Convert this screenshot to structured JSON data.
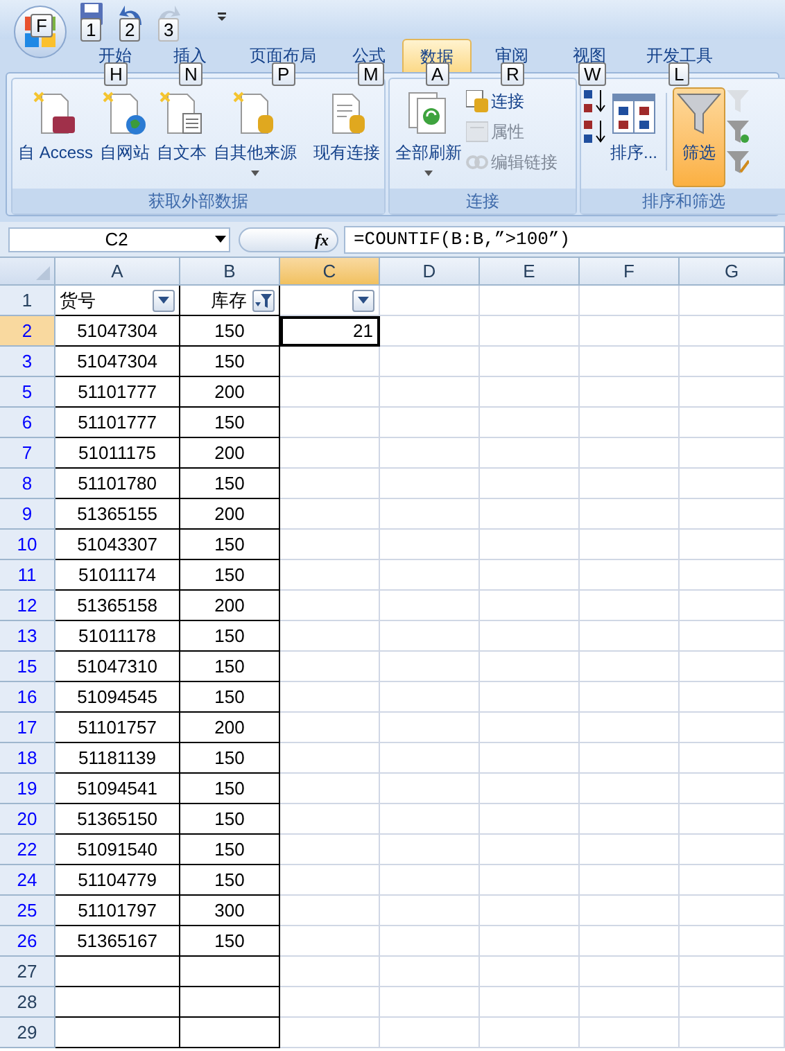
{
  "title_bar": {
    "office_button_keytip": "F",
    "quick_access": [
      {
        "keytip": "1",
        "disabled": false
      },
      {
        "keytip": "2",
        "disabled": false
      },
      {
        "keytip": "3",
        "disabled": true
      }
    ]
  },
  "tabs": [
    {
      "label": "开始",
      "keytip": "H",
      "selected": false
    },
    {
      "label": "插入",
      "keytip": "N",
      "selected": false
    },
    {
      "label": "页面布局",
      "keytip": "P",
      "selected": false
    },
    {
      "label": "公式",
      "keytip": "M",
      "selected": false
    },
    {
      "label": "数据",
      "keytip": "A",
      "selected": true
    },
    {
      "label": "审阅",
      "keytip": "R",
      "selected": false
    },
    {
      "label": "视图",
      "keytip": "W",
      "selected": false
    },
    {
      "label": "开发工具",
      "keytip": "L",
      "selected": false
    }
  ],
  "ribbon": {
    "groups": [
      {
        "title": "获取外部数据",
        "items": [
          {
            "kind": "large",
            "label": "自 Access",
            "dropdown": false,
            "on": false
          },
          {
            "kind": "large",
            "label": "自网站",
            "dropdown": false,
            "on": false
          },
          {
            "kind": "large",
            "label": "自文本",
            "dropdown": false,
            "on": false
          },
          {
            "kind": "large",
            "label": "自其他来源",
            "dropdown": true,
            "on": false
          },
          {
            "kind": "separator"
          },
          {
            "kind": "large",
            "label": "现有连接",
            "dropdown": false,
            "on": false
          }
        ]
      },
      {
        "title": "连接",
        "items": [
          {
            "kind": "large",
            "label": "全部刷新",
            "dropdown": true,
            "on": false
          },
          {
            "kind": "stack",
            "items": [
              {
                "label": "连接",
                "disabled": false
              },
              {
                "label": "属性",
                "disabled": true
              },
              {
                "label": "编辑链接",
                "disabled": true
              }
            ]
          }
        ]
      },
      {
        "title": "排序和筛选",
        "items": [
          {
            "kind": "stack",
            "items": [
              {
                "disabled": false
              },
              {
                "disabled": false
              }
            ]
          },
          {
            "kind": "large",
            "label": "排序...",
            "dropdown": false,
            "on": false
          },
          {
            "kind": "separator"
          },
          {
            "kind": "large",
            "label": "筛选",
            "dropdown": false,
            "on": true
          },
          {
            "kind": "stack",
            "items": [
              {
                "disabled": true
              },
              {
                "disabled": false
              },
              {
                "disabled": false
              }
            ]
          }
        ]
      }
    ]
  },
  "formula_bar": {
    "name_box": "C2",
    "function_button": "fx",
    "formula": "=COUNTIF(B:B,”>100”)"
  },
  "columns": [
    {
      "label": "A",
      "selected": false
    },
    {
      "label": "B",
      "selected": false
    },
    {
      "label": "C",
      "selected": true
    },
    {
      "label": "D",
      "selected": false
    },
    {
      "label": "E",
      "selected": false
    },
    {
      "label": "F",
      "selected": false
    },
    {
      "label": "G",
      "selected": false
    }
  ],
  "header_row": {
    "number": "1",
    "cells": [
      {
        "text": "货号",
        "filtered": false
      },
      {
        "text": "库存",
        "filtered": true
      },
      {
        "filtered": false
      }
    ]
  },
  "rows": [
    {
      "number": "2",
      "filtered": true,
      "selected": true,
      "a": "51047304",
      "b": "150",
      "c": "21"
    },
    {
      "number": "3",
      "filtered": true,
      "selected": false,
      "a": "51047304",
      "b": "150"
    },
    {
      "number": "5",
      "filtered": true,
      "selected": false,
      "a": "51101777",
      "b": "200"
    },
    {
      "number": "6",
      "filtered": true,
      "selected": false,
      "a": "51101777",
      "b": "150"
    },
    {
      "number": "7",
      "filtered": true,
      "selected": false,
      "a": "51011175",
      "b": "200"
    },
    {
      "number": "8",
      "filtered": true,
      "selected": false,
      "a": "51101780",
      "b": "150"
    },
    {
      "number": "9",
      "filtered": true,
      "selected": false,
      "a": "51365155",
      "b": "200"
    },
    {
      "number": "10",
      "filtered": true,
      "selected": false,
      "a": "51043307",
      "b": "150"
    },
    {
      "number": "11",
      "filtered": true,
      "selected": false,
      "a": "51011174",
      "b": "150"
    },
    {
      "number": "12",
      "filtered": true,
      "selected": false,
      "a": "51365158",
      "b": "200"
    },
    {
      "number": "13",
      "filtered": true,
      "selected": false,
      "a": "51011178",
      "b": "150"
    },
    {
      "number": "15",
      "filtered": true,
      "selected": false,
      "a": "51047310",
      "b": "150"
    },
    {
      "number": "16",
      "filtered": true,
      "selected": false,
      "a": "51094545",
      "b": "150"
    },
    {
      "number": "17",
      "filtered": true,
      "selected": false,
      "a": "51101757",
      "b": "200"
    },
    {
      "number": "18",
      "filtered": true,
      "selected": false,
      "a": "51181139",
      "b": "150"
    },
    {
      "number": "19",
      "filtered": true,
      "selected": false,
      "a": "51094541",
      "b": "150"
    },
    {
      "number": "20",
      "filtered": true,
      "selected": false,
      "a": "51365150",
      "b": "150"
    },
    {
      "number": "22",
      "filtered": true,
      "selected": false,
      "a": "51091540",
      "b": "150"
    },
    {
      "number": "24",
      "filtered": true,
      "selected": false,
      "a": "51104779",
      "b": "150"
    },
    {
      "number": "25",
      "filtered": true,
      "selected": false,
      "a": "51101797",
      "b": "300"
    },
    {
      "number": "26",
      "filtered": true,
      "selected": false,
      "a": "51365167",
      "b": "150"
    },
    {
      "number": "27",
      "filtered": false,
      "selected": false
    },
    {
      "number": "28",
      "filtered": false,
      "selected": false
    },
    {
      "number": "29",
      "filtered": false,
      "selected": false
    }
  ]
}
